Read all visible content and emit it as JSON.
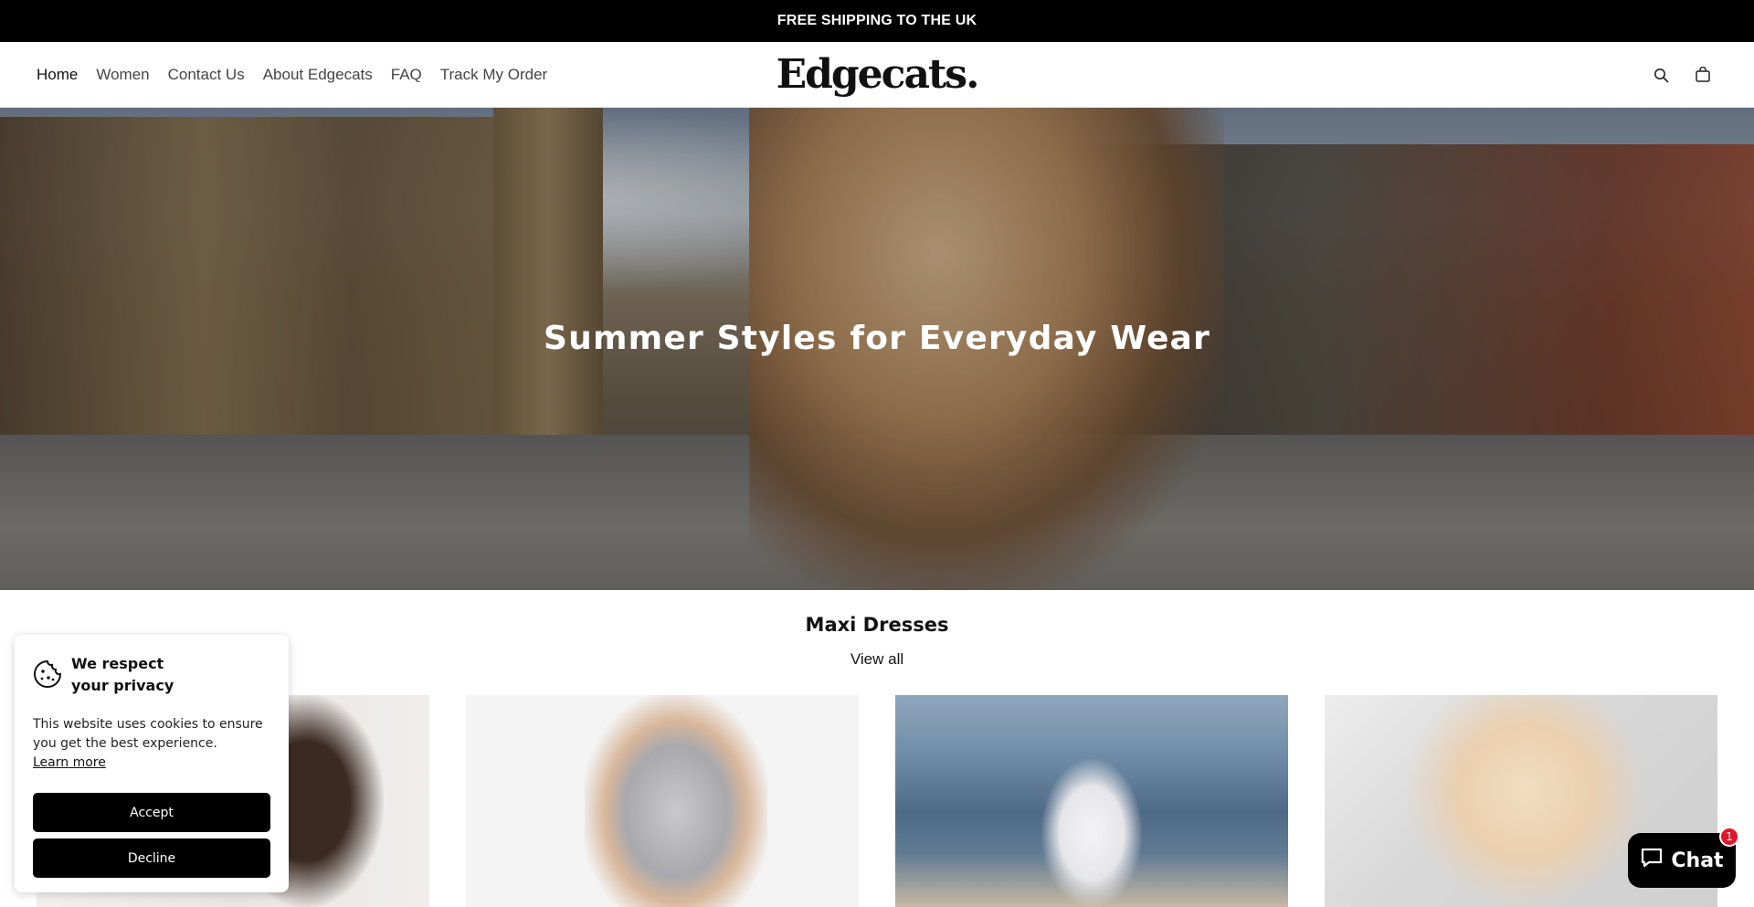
{
  "announcement": {
    "text": "FREE SHIPPING TO THE UK"
  },
  "header": {
    "logo": "Edgecats.",
    "nav": [
      {
        "label": "Home",
        "active": true
      },
      {
        "label": "Women",
        "active": false
      },
      {
        "label": "Contact Us",
        "active": false
      },
      {
        "label": "About Edgecats",
        "active": false
      },
      {
        "label": "FAQ",
        "active": false
      },
      {
        "label": "Track My Order",
        "active": false
      }
    ],
    "icons": [
      "search-icon",
      "cart-icon"
    ]
  },
  "hero": {
    "title": "Summer Styles for Everyday Wear"
  },
  "collection": {
    "title": "Maxi Dresses",
    "view_all": "View all",
    "products": [
      {
        "image": "brown ruffled dress"
      },
      {
        "image": "silver metallic dress"
      },
      {
        "image": "white strapless dress"
      },
      {
        "image": "champagne ruffle dress"
      }
    ]
  },
  "cookie": {
    "title_line1": "We respect",
    "title_line2": "your privacy",
    "text": "This website uses cookies to ensure you get the best experience.",
    "learn_more": "Learn more",
    "accept": "Accept",
    "decline": "Decline"
  },
  "chat": {
    "label": "Chat",
    "badge": "1"
  },
  "colors": {
    "announce_bg": "#000000",
    "button_bg": "#000000",
    "badge": "#e0162b"
  }
}
